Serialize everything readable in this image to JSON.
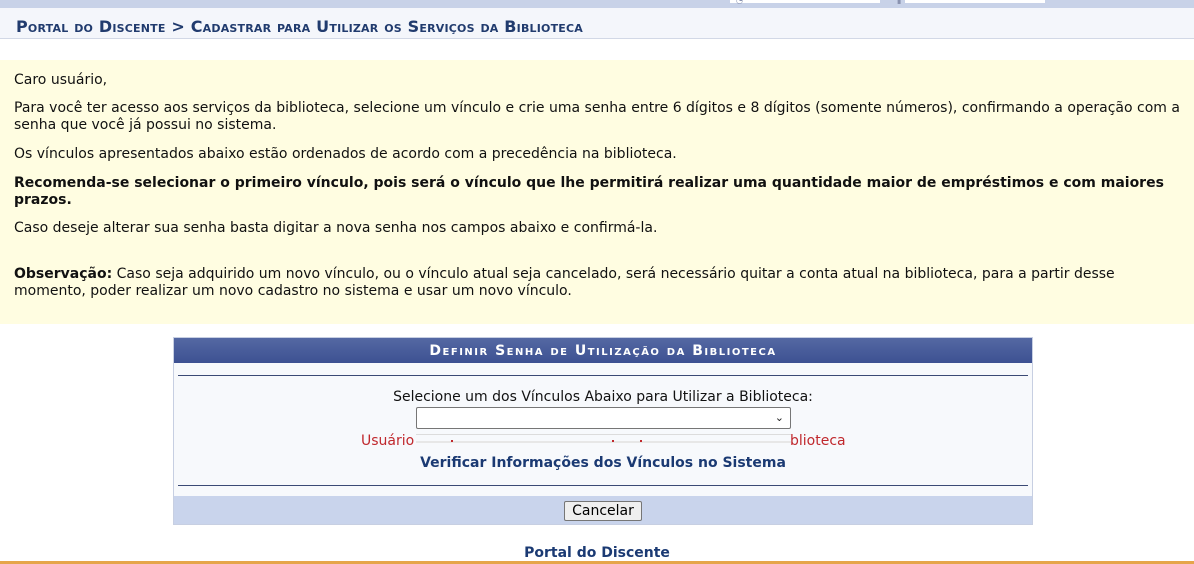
{
  "header": {
    "breadcrumb": "Portal do Discente > Cadastrar para Utilizar os Serviços da Biblioteca"
  },
  "notice": {
    "greeting": "Caro usuário,",
    "paragraph1": "Para você ter acesso aos serviços da biblioteca, selecione um vínculo e crie uma senha entre 6 dígitos e 8 dígitos (somente números), confirmando a operação com a senha que você já possui no sistema.",
    "paragraph2": "Os vínculos apresentados abaixo estão ordenados de acordo com a precedência na biblioteca.",
    "recommendation": "Recomenda-se selecionar o primeiro vínculo, pois será o vínculo que lhe permitirá realizar uma quantidade maior de empréstimos e com maiores prazos.",
    "paragraph3": "Caso deseje alterar sua senha basta digitar a nova senha nos campos abaixo e confirmá-la.",
    "observation_label": "Observação:",
    "observation_text": " Caso seja adquirido um novo vínculo, ou o vínculo atual seja cancelado, será necessário quitar a conta atual na biblioteca, para a partir desse momento, poder realizar um novo cadastro no sistema e usar um novo vínculo."
  },
  "form": {
    "title": "Definir Senha de Utilização da Biblioteca",
    "select_label": "Selecione um dos Vínculos Abaixo para Utilizar a Biblioteca:",
    "select_value": "",
    "usuario_label_fragment": "Usuário",
    "biblioteca_label_fragment": "blioteca",
    "verify_link": "Verificar Informações dos Vínculos no Sistema",
    "cancel_button": "Cancelar"
  },
  "footer": {
    "portal_link": "Portal do Discente"
  },
  "colors": {
    "header_text": "#213b6e",
    "notice_bg": "#fffde1",
    "panel_header": "#4a5c98",
    "error_red": "#c0282d",
    "footer_accent": "#e6a54a"
  }
}
